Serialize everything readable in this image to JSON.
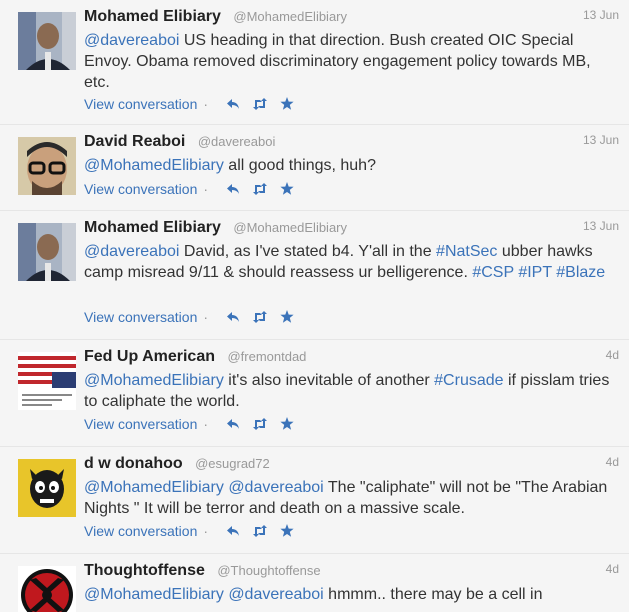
{
  "view_conversation": "View conversation",
  "separator": "·",
  "icons": {
    "reply": "reply-icon",
    "retweet": "retweet-icon",
    "favorite": "star-icon"
  },
  "colors": {
    "link": "#3b73b9",
    "muted": "#999999",
    "text": "#333333"
  },
  "tweets": [
    {
      "name": "Mohamed Elibiary",
      "handle": "@MohamedElibiary",
      "time": "13 Jun",
      "segments": [
        {
          "t": "@davereaboi",
          "link": true
        },
        {
          "t": " US heading in that direction. Bush created OIC Special Envoy. Obama removed discriminatory engagement policy towards MB, etc.",
          "link": false
        }
      ]
    },
    {
      "name": "David Reaboi",
      "handle": "@davereaboi",
      "time": "13 Jun",
      "segments": [
        {
          "t": "@MohamedElibiary",
          "link": true
        },
        {
          "t": " all good things, huh?",
          "link": false
        }
      ]
    },
    {
      "name": "Mohamed Elibiary",
      "handle": "@MohamedElibiary",
      "time": "13 Jun",
      "segments": [
        {
          "t": "@davereaboi",
          "link": true
        },
        {
          "t": " David, as I've stated b4. Y'all in the ",
          "link": false
        },
        {
          "t": "#NatSec",
          "link": true
        },
        {
          "t": " ubber hawks camp misread 9/11 & should reassess ur belligerence. ",
          "link": false
        },
        {
          "t": "#CSP",
          "link": true
        },
        {
          "t": " ",
          "link": false
        },
        {
          "t": "#IPT",
          "link": true
        },
        {
          "t": " ",
          "link": false
        },
        {
          "t": "#Blaze",
          "link": true
        }
      ]
    },
    {
      "name": "Fed Up American",
      "handle": "@fremontdad",
      "time": "4d",
      "segments": [
        {
          "t": "@MohamedElibiary",
          "link": true
        },
        {
          "t": " it's also inevitable of another ",
          "link": false
        },
        {
          "t": "#Crusade",
          "link": true
        },
        {
          "t": " if pisslam tries to caliphate the world.",
          "link": false
        }
      ]
    },
    {
      "name": "d w donahoo",
      "handle": "@esugrad72",
      "time": "4d",
      "segments": [
        {
          "t": "@MohamedElibiary",
          "link": true
        },
        {
          "t": " ",
          "link": false
        },
        {
          "t": "@davereaboi",
          "link": true
        },
        {
          "t": " The \"caliphate\" will not be \"The Arabian Nights \" It will be terror and death on a massive scale.",
          "link": false
        }
      ]
    },
    {
      "name": "Thoughtoffense",
      "handle": "@Thoughtoffense",
      "time": "4d",
      "segments": [
        {
          "t": "@MohamedElibiary",
          "link": true
        },
        {
          "t": " ",
          "link": false
        },
        {
          "t": "@davereaboi",
          "link": true
        },
        {
          "t": " hmmm.. there may be a cell in",
          "link": false
        }
      ]
    }
  ]
}
